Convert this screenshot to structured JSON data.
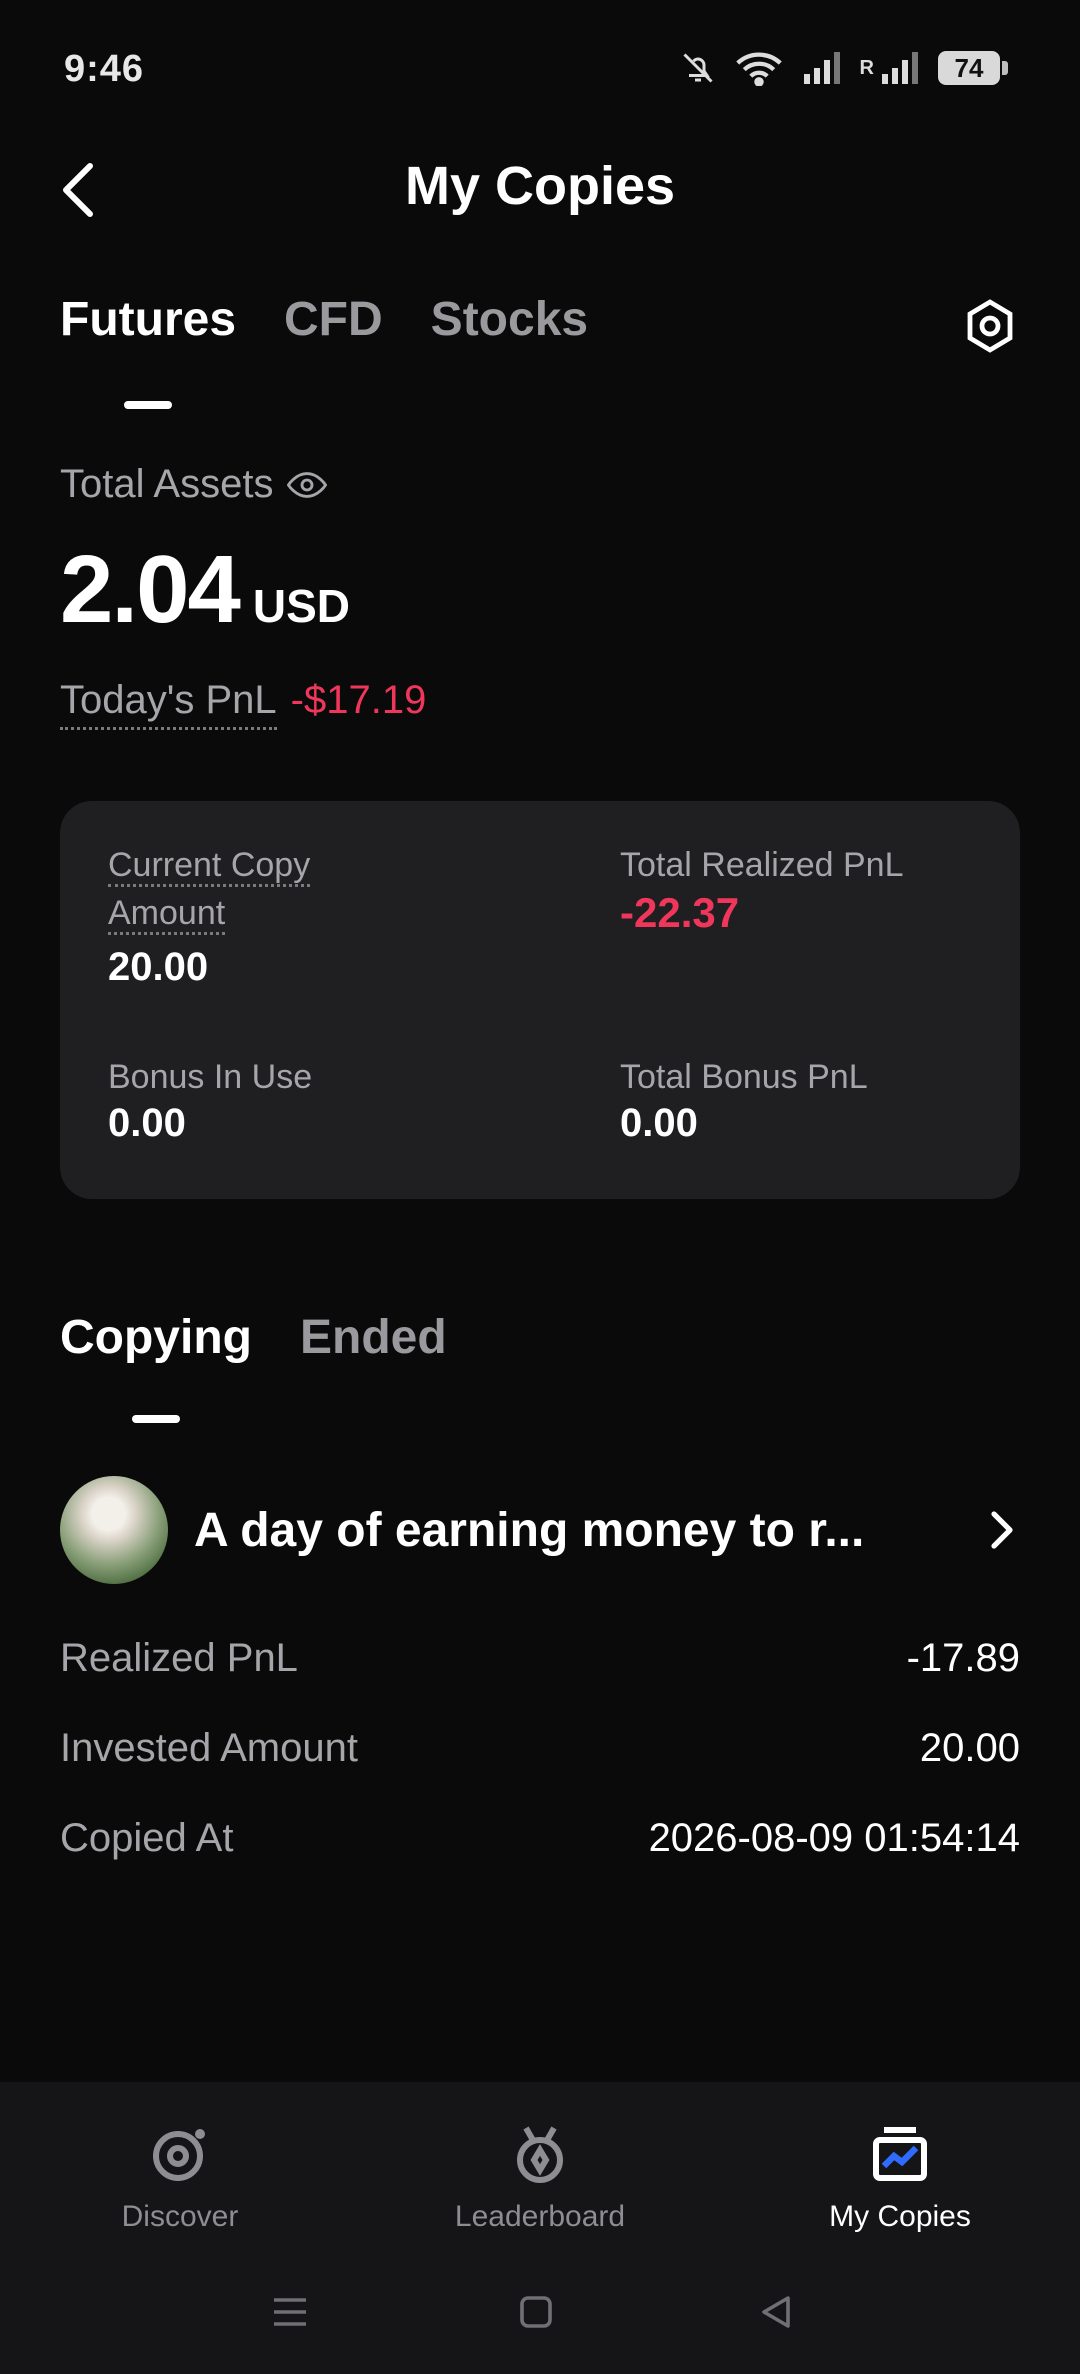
{
  "status_bar": {
    "time": "9:46",
    "battery": "74",
    "icons": [
      "mute-bell-icon",
      "wifi-icon",
      "signal-icon",
      "signal-roaming-icon",
      "battery-icon"
    ],
    "roaming_label": "R"
  },
  "header": {
    "title": "My Copies",
    "back_icon": "back-arrow-icon"
  },
  "tabs": [
    {
      "label": "Futures",
      "active": true
    },
    {
      "label": "CFD",
      "active": false
    },
    {
      "label": "Stocks",
      "active": false
    }
  ],
  "settings_icon": "settings-icon",
  "assets": {
    "label": "Total Assets",
    "value": "2.04",
    "unit": "USD",
    "todays_pnl_label": "Today's PnL",
    "todays_pnl_value": "-$17.19"
  },
  "summary_card": {
    "current_copy_amount_label_1": "Current Copy",
    "current_copy_amount_label_2": "Amount",
    "current_copy_amount_value": "20.00",
    "total_realized_pnl_label": "Total Realized PnL",
    "total_realized_pnl_value": "-22.37",
    "bonus_in_use_label": "Bonus In Use",
    "bonus_in_use_value": "0.00",
    "total_bonus_pnl_label": "Total Bonus PnL",
    "total_bonus_pnl_value": "0.00"
  },
  "sub_tabs": [
    {
      "label": "Copying",
      "active": true
    },
    {
      "label": "Ended",
      "active": false
    }
  ],
  "copy_item": {
    "trader_name": "A day of earning money to r...",
    "rows": [
      {
        "label": "Realized PnL",
        "value": "-17.89"
      },
      {
        "label": "Invested Amount",
        "value": "20.00"
      },
      {
        "label": "Copied At",
        "value": "2026-08-09 01:54:14"
      }
    ]
  },
  "bottom_nav": [
    {
      "label": "Discover",
      "icon": "discover-icon",
      "active": false
    },
    {
      "label": "Leaderboard",
      "icon": "leaderboard-medal-icon",
      "active": false
    },
    {
      "label": "My Copies",
      "icon": "my-copies-icon",
      "active": true
    }
  ],
  "colors": {
    "background": "#0a0a0b",
    "card": "#1f1f22",
    "negative": "#f0375b",
    "accent": "#2f6bff"
  }
}
